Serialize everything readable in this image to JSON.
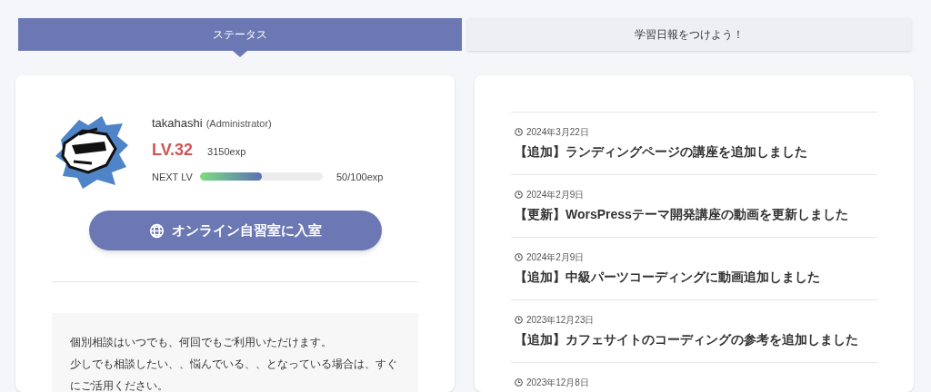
{
  "tabs": [
    {
      "label": "ステータス",
      "selected": true
    },
    {
      "label": "学習日報をつけよう！",
      "selected": false
    }
  ],
  "profile": {
    "username": "takahashi",
    "role": "(Administrator)",
    "level": "LV.32",
    "exp": "3150exp",
    "next_label": "NEXT LV",
    "progress": {
      "level": 0.5
    },
    "progress_reading": "50/100exp"
  },
  "enter_button": {
    "label": "オンライン自習室に入室"
  },
  "notice": [
    "個別相談はいつでも、何回でもご利用いただけます。",
    "少しでも相談したい、、悩んでいる、、となっている場合は、すぐにご活用ください。"
  ],
  "news": [
    {
      "date": "2024年3月22日",
      "title": "【追加】ランディングページの講座を追加しました"
    },
    {
      "date": "2024年2月9日",
      "title": "【更新】WorsPressテーマ開発講座の動画を更新しました"
    },
    {
      "date": "2024年2月9日",
      "title": "【追加】中級パーツコーディングに動画追加しました"
    },
    {
      "date": "2023年12月23日",
      "title": "【追加】カフェサイトのコーディングの参考を追加しました"
    },
    {
      "date": "2023年12月8日"
    }
  ]
}
